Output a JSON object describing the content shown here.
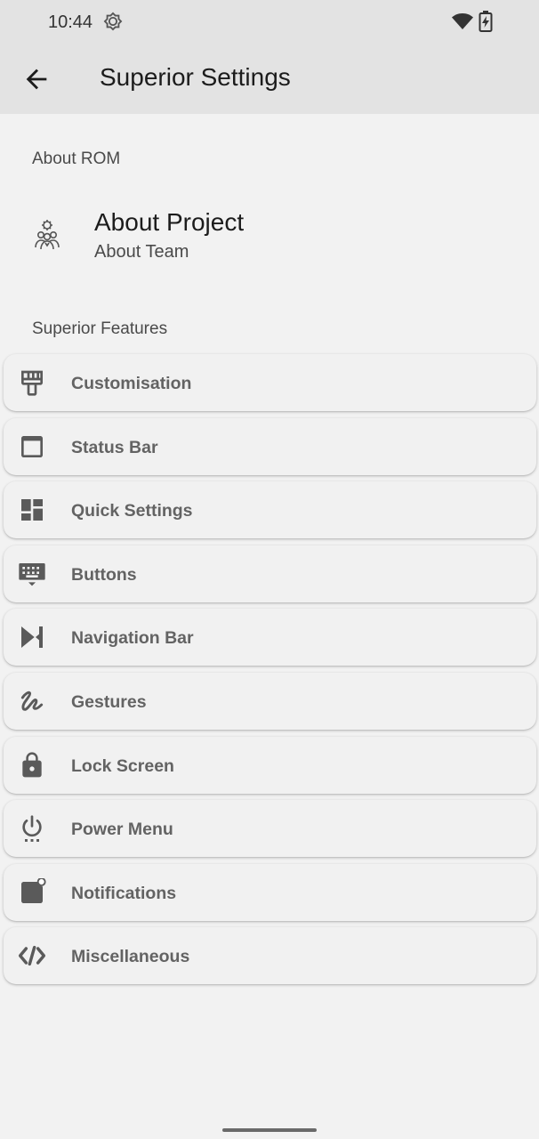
{
  "status_bar": {
    "time": "10:44",
    "icons": [
      "sync-brightness-icon",
      "wifi-icon",
      "battery-charging-icon"
    ]
  },
  "app_bar": {
    "title": "Superior Settings",
    "back_icon": "arrow-back-icon"
  },
  "sections": {
    "about_rom": "About ROM",
    "superior_features": "Superior Features"
  },
  "about": {
    "title": "About Project",
    "subtitle": "About Team",
    "icon": "team-icon"
  },
  "features": [
    {
      "label": "Customisation",
      "icon": "paint-brush-icon"
    },
    {
      "label": "Status Bar",
      "icon": "status-bar-icon"
    },
    {
      "label": "Quick Settings",
      "icon": "dashboard-tiles-icon"
    },
    {
      "label": "Buttons",
      "icon": "keyboard-icon"
    },
    {
      "label": "Navigation Bar",
      "icon": "navigation-icon"
    },
    {
      "label": "Gestures",
      "icon": "gesture-icon"
    },
    {
      "label": "Lock Screen",
      "icon": "lock-icon"
    },
    {
      "label": "Power Menu",
      "icon": "power-icon"
    },
    {
      "label": "Notifications",
      "icon": "notification-dot-icon"
    },
    {
      "label": "Miscellaneous",
      "icon": "code-icon"
    }
  ],
  "colors": {
    "background": "#f2f2f2",
    "app_bar": "#e3e3e3",
    "card_label": "#636363",
    "icon": "#5a5a5a"
  }
}
